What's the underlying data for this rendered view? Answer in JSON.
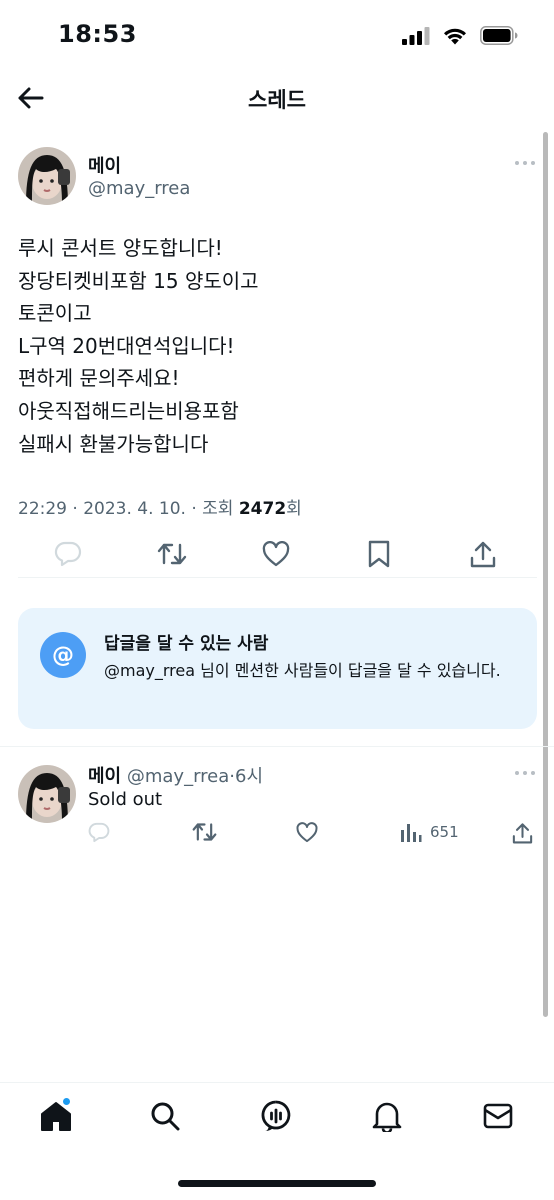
{
  "status": {
    "time": "18:53"
  },
  "header": {
    "title": "스레드"
  },
  "tweet": {
    "author_name": "메이",
    "author_handle": "@may_rrea",
    "lines": [
      "루시 콘서트 양도합니다!",
      "장당티켓비포함 15 양도이고",
      "토콘이고",
      "L구역 20번대연석입니다!",
      "편하게 문의주세요!",
      "아웃직접해드리는비용포함",
      "실패시 환불가능합니다"
    ],
    "meta_prefix": "22:29 · 2023. 4. 10. · 조회 ",
    "views": "2472",
    "meta_suffix": "회"
  },
  "reply_settings": {
    "icon": "@",
    "title": "답글을 달 수 있는 사람",
    "description": "@may_rrea 님이 멘션한 사람들이 답글을 달 수 있습니다."
  },
  "reply": {
    "author_name": "메이",
    "author_handle": "@may_rrea",
    "time": "·6시",
    "text": "Sold out",
    "views": "651"
  },
  "icons": {
    "back": "arrow-left-icon",
    "more": "more-horizontal-icon",
    "reply": "reply-icon",
    "retweet": "retweet-icon",
    "like": "heart-icon",
    "bookmark": "bookmark-icon",
    "share": "share-icon",
    "views": "bar-chart-icon",
    "tabs": [
      "home-icon",
      "search-icon",
      "spaces-icon",
      "bell-icon",
      "mail-icon"
    ]
  },
  "colors": {
    "accent": "#1d9bf0",
    "reply_card_bg": "#e8f4fd",
    "reply_icon_bg": "#4d9ef5",
    "muted": "#536471"
  }
}
